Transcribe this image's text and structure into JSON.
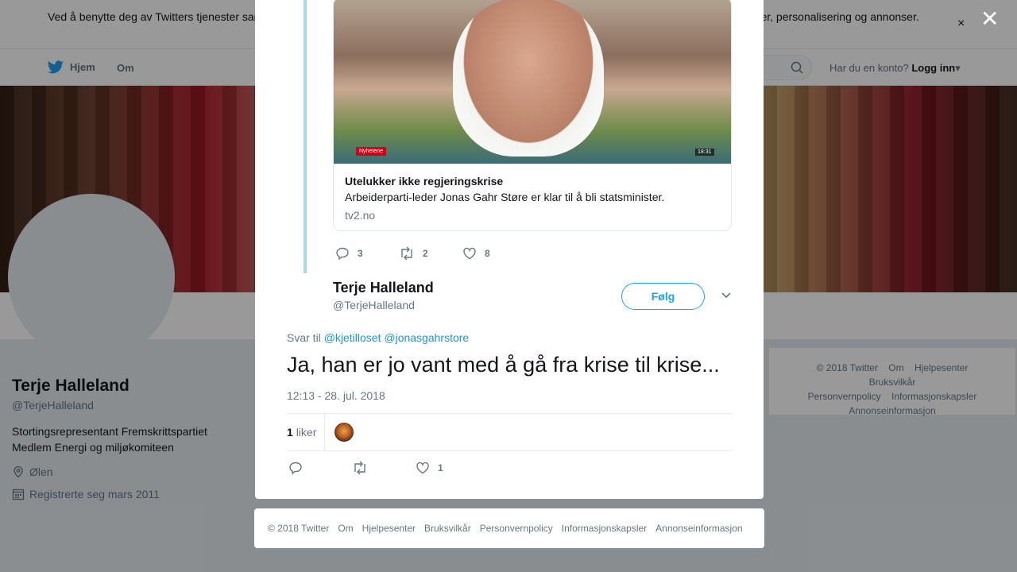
{
  "cookie_bar": {
    "text": "Ved å benytte deg av Twitters tjenester samtykker du i bruk av informasjonskapsler. Twitter og partnere bruker informasjonskapsler til bl.a. analyser, personalisering og annonser.",
    "close": "×"
  },
  "nav": {
    "home": "Hjem",
    "about": "Om",
    "account_prompt": "Har du en konto?",
    "login": "Logg inn"
  },
  "profile": {
    "name": "Terje Halleland",
    "handle": "@TerjeHalleland",
    "bio": "Stortingsrepresentant Fremskrittspartiet Medlem Energi og miljøkomiteen",
    "location": "Ølen",
    "joined": "Registrerte seg mars 2011"
  },
  "side_footer": {
    "copyright": "© 2018 Twitter",
    "links": [
      "Om",
      "Hjelpesenter",
      "Bruksvilkår",
      "Personvernpolicy",
      "Informasjonskapsler",
      "Annonseinformasjon"
    ]
  },
  "overlay": {
    "close": "✕"
  },
  "quoted_tweet": {
    "card": {
      "badge": "Nyhetene",
      "video_time": "18:31",
      "title": "Utelukker ikke regjeringskrise",
      "description": "Arbeiderparti-leder Jonas Gahr Støre er klar til å bli statsminister.",
      "domain": "tv2.no"
    },
    "actions": {
      "replies": "3",
      "retweets": "2",
      "likes": "8"
    }
  },
  "tweet": {
    "author_name": "Terje Halleland",
    "author_handle": "@TerjeHalleland",
    "follow_label": "Følg",
    "reply_prefix": "Svar til",
    "reply_to": [
      "@kjetilloset",
      "@jonasgahrstore"
    ],
    "text": "Ja, han er jo vant med å gå fra krise til krise...",
    "timestamp": "12:13 - 28. jul. 2018",
    "like_count": "1",
    "like_label": "liker",
    "actions": {
      "replies": "",
      "retweets": "",
      "likes": "1"
    }
  },
  "modal_footer": {
    "copyright": "© 2018 Twitter",
    "links": [
      "Om",
      "Hjelpesenter",
      "Bruksvilkår",
      "Personvernpolicy",
      "Informasjonskapsler",
      "Annonseinformasjon"
    ]
  },
  "colors": {
    "accent": "#1da1f2",
    "link": "#1b95e0",
    "thread_line": "#a8d6f5",
    "muted": "#657786"
  }
}
